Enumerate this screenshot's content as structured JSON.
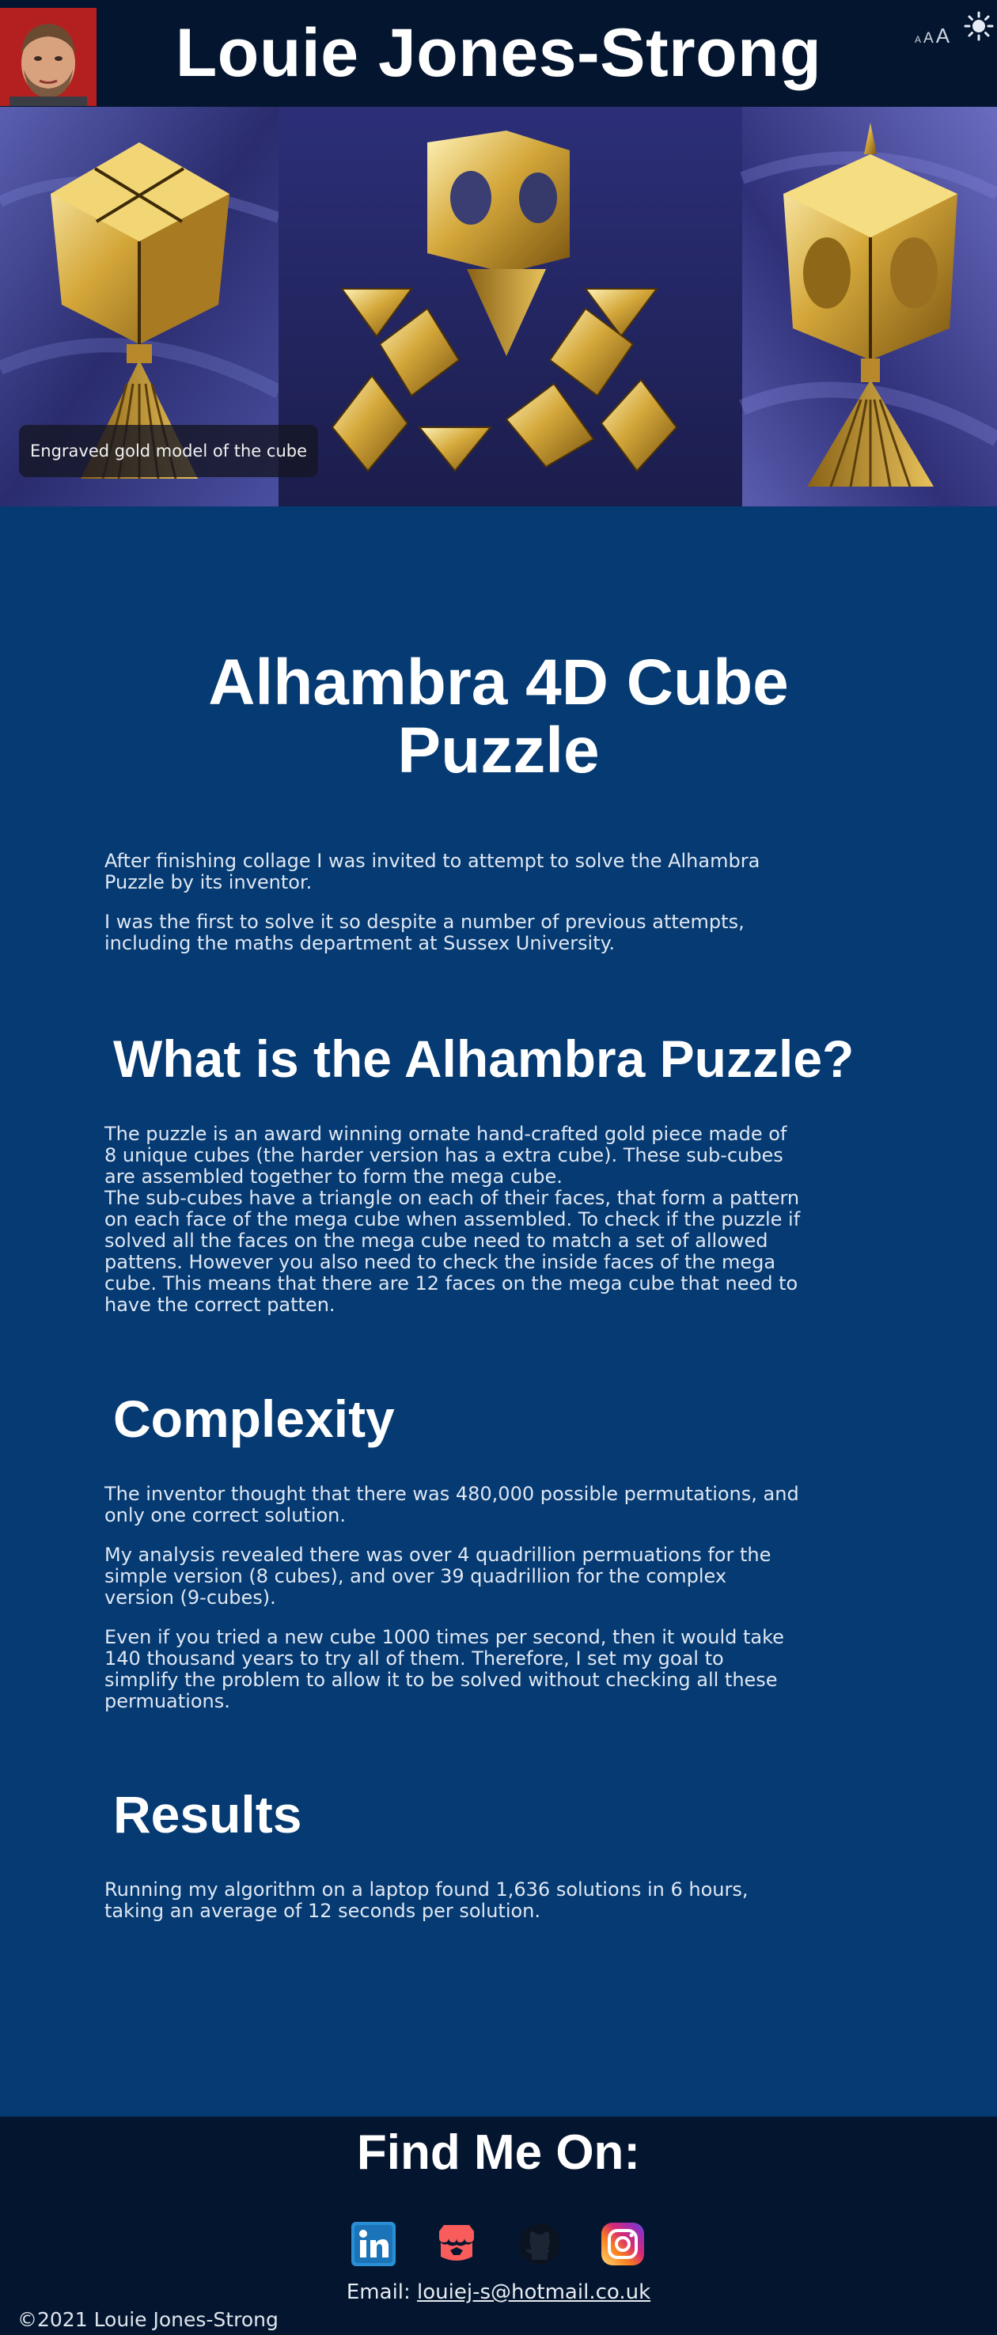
{
  "header": {
    "site_title": "Louie Jones-Strong",
    "avatar_icon": "avatar-icon",
    "font_controls": {
      "small": "A",
      "medium": "A",
      "large": "A"
    },
    "theme_icon": "sun-icon"
  },
  "hero": {
    "caption": "Engraved gold model of the cube"
  },
  "main": {
    "title": "Alhambra 4D Cube Puzzle",
    "intro": [
      "After finishing collage I was invited to attempt to solve the Alhambra Puzzle by its inventor.",
      "I was the first to solve it so despite a number of previous attempts, including the maths department at Sussex University."
    ],
    "what_heading": "What is the Alhambra Puzzle?",
    "what_paragraphs": [
      "The puzzle is an award winning ornate hand-crafted gold piece made of 8 unique cubes (the harder version has a extra cube). These sub-cubes are assembled together to form the mega cube.",
      "The sub-cubes have a triangle on each of their faces, that form a pattern on each face of the mega cube when assembled. To check if the puzzle if solved all the faces on the mega cube need to match a set of allowed pattens. However you also need to check the inside faces of the mega cube. This means that there are 12 faces on the mega cube that need to have the correct patten."
    ],
    "complexity_heading": "Complexity",
    "complexity_paragraphs": [
      "The inventor thought that there was 480,000 possible permutations, and only one correct solution.",
      "My analysis revealed there was over 4 quadrillion permuations for the simple version (8 cubes), and over 39 quadrillion for the complex version (9-cubes).",
      "Even if you tried a new cube 1000 times per second, then it would take 140 thousand years to try all of them. Therefore, I set my goal to simplify the problem to allow it to be solved without checking all these permuations."
    ],
    "results_heading": "Results",
    "results_paragraphs": [
      "Running my algorithm on a laptop found 1,636 solutions in 6 hours, taking an average of 12 seconds per solution."
    ]
  },
  "footer": {
    "heading": "Find Me On:",
    "social_icons": [
      "linkedin-icon",
      "itchio-icon",
      "github-icon",
      "instagram-icon"
    ],
    "email_label": "Email: ",
    "email_address": "louiej-s@hotmail.co.uk",
    "copyright": "©2021 Louie Jones-Strong"
  },
  "colors": {
    "header_bg": "#04162f",
    "main_bg": "#053a72",
    "avatar_bg": "#b3201f",
    "gold": "#d4a73a"
  }
}
